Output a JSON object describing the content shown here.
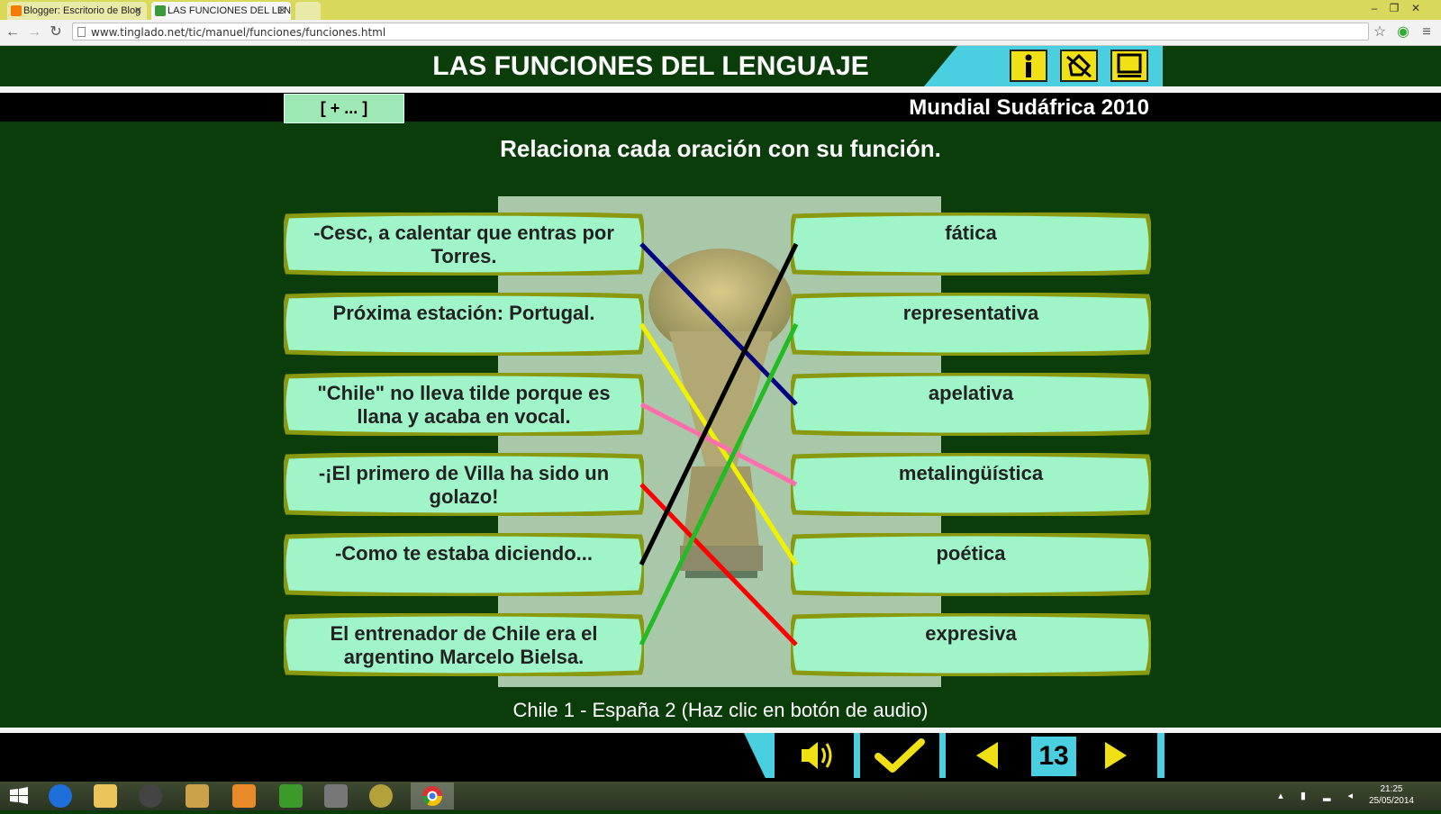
{
  "browser": {
    "tabs": [
      {
        "title": "Blogger: Escritorio de Blog",
        "active": false
      },
      {
        "title": "LAS FUNCIONES DEL LENGU",
        "active": true
      }
    ],
    "url": "www.tinglado.net/tic/manuel/funciones/funciones.html"
  },
  "app": {
    "title": "LAS FUNCIONES DEL LENGUAJE",
    "more_button": "[ + ... ]",
    "subtitle": "Mundial Sudáfrica 2010",
    "instruction": "Relaciona cada oración con su función.",
    "footer": "Chile 1 - España 2  (Haz clic en botón de audio)",
    "page_number": "13",
    "header_buttons": [
      "info-icon",
      "drag-icon",
      "screen-icon"
    ],
    "bottom_buttons": [
      "audio-icon",
      "check-icon",
      "prev-arrow-icon",
      "next-arrow-icon"
    ]
  },
  "sentences": [
    "-Cesc, a calentar que entras por Torres.",
    "Próxima estación: Portugal.",
    "\"Chile\" no lleva tilde porque es llana y acaba en vocal.",
    "-¡El primero de Villa ha sido un golazo!",
    "-Como te estaba diciendo...",
    "El entrenador de Chile era el argentino Marcelo Bielsa."
  ],
  "functions": [
    "fática",
    "representativa",
    "apelativa",
    "metalingüística",
    "poética",
    "expresiva"
  ],
  "connections": [
    {
      "from": 0,
      "to": 2,
      "color": "#000080"
    },
    {
      "from": 1,
      "to": 4,
      "color": "#f0f000"
    },
    {
      "from": 2,
      "to": 3,
      "color": "#ff6fae"
    },
    {
      "from": 3,
      "to": 5,
      "color": "#ff0000"
    },
    {
      "from": 4,
      "to": 0,
      "color": "#000000"
    },
    {
      "from": 5,
      "to": 1,
      "color": "#22bb22"
    }
  ],
  "taskbar": {
    "time": "21:25",
    "date": "25/05/2014"
  },
  "colors": {
    "background": "#0b3d0b",
    "card_fill": "#9ff5c8",
    "card_border": "#8a9a10",
    "accent_cyan": "#49cfe0",
    "button_yellow": "#f1e014"
  }
}
